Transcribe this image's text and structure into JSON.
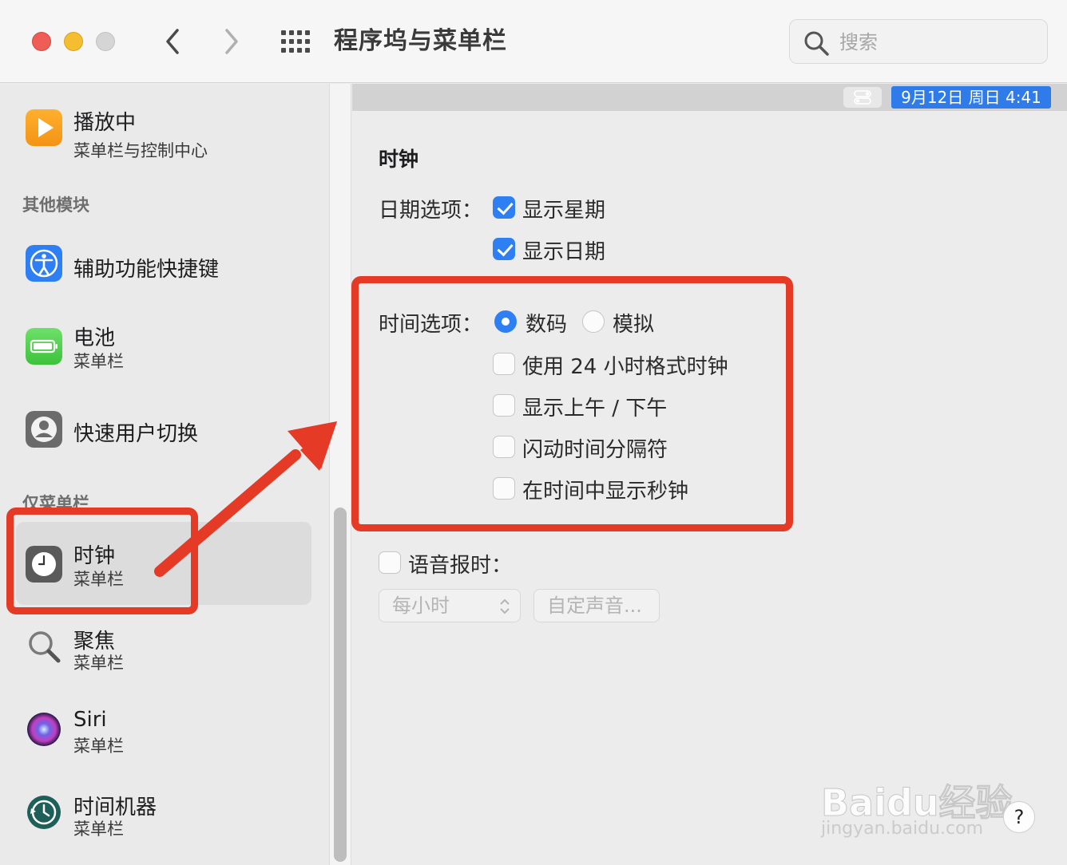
{
  "window": {
    "title": "程序坞与菜单栏",
    "search_placeholder": "搜索"
  },
  "sidebar": {
    "items": [
      {
        "title": "播放中",
        "subtitle": "菜单栏与控制中心",
        "icon": "play-icon"
      },
      {
        "title": "辅助功能快捷键",
        "subtitle": "",
        "icon": "accessibility-icon"
      },
      {
        "title": "电池",
        "subtitle": "菜单栏",
        "icon": "battery-icon"
      },
      {
        "title": "快速用户切换",
        "subtitle": "",
        "icon": "user-switch-icon"
      },
      {
        "title": "时钟",
        "subtitle": "菜单栏",
        "icon": "clock-icon",
        "selected": true
      },
      {
        "title": "聚焦",
        "subtitle": "菜单栏",
        "icon": "spotlight-icon"
      },
      {
        "title": "Siri",
        "subtitle": "菜单栏",
        "icon": "siri-icon"
      },
      {
        "title": "时间机器",
        "subtitle": "菜单栏",
        "icon": "time-machine-icon"
      }
    ],
    "sections": {
      "other_modules": "其他模块",
      "menu_bar_only": "仅菜单栏"
    }
  },
  "preview": {
    "clock_text": "9月12日 周日  4:41"
  },
  "clock": {
    "section_title": "时钟",
    "date_options_label": "日期选项：",
    "show_weekday": {
      "label": "显示星期",
      "checked": true
    },
    "show_date": {
      "label": "显示日期",
      "checked": true
    },
    "time_options_label": "时间选项：",
    "digital": {
      "label": "数码",
      "selected": true
    },
    "analog": {
      "label": "模拟",
      "selected": false
    },
    "use_24h": {
      "label": "使用 24 小时格式时钟",
      "checked": false
    },
    "show_ampm": {
      "label": "显示上午 / 下午",
      "checked": false
    },
    "flash_separators": {
      "label": "闪动时间分隔符",
      "checked": false
    },
    "show_seconds": {
      "label": "在时间中显示秒钟",
      "checked": false
    },
    "announce_time": {
      "label": "语音报时：",
      "checked": false
    },
    "interval_value": "每小时",
    "custom_voice_button": "自定声音..."
  },
  "watermark": {
    "logo": "Baidu经验",
    "url": "jingyan.baidu.com"
  },
  "help_label": "?",
  "colors": {
    "accent": "#2f7ff4",
    "annotation": "#e43a26"
  }
}
